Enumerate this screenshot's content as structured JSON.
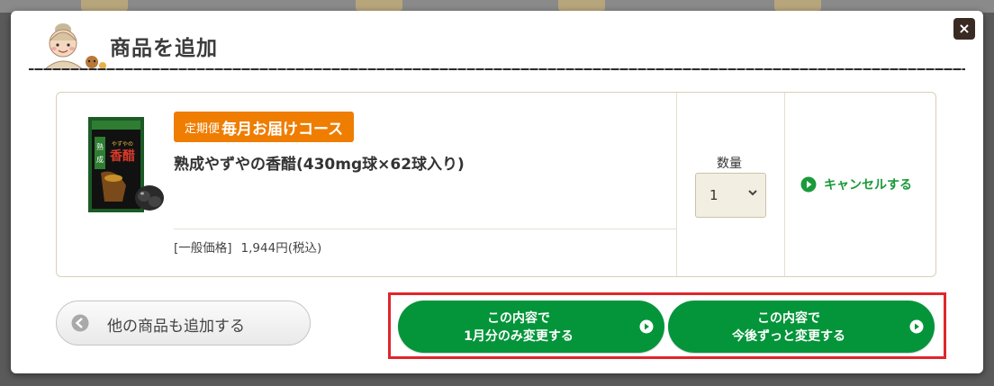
{
  "dialog": {
    "title": "商品を追加",
    "close_label": "×"
  },
  "product": {
    "badge_small": "定期便",
    "badge_big": "毎月お届けコース",
    "name": "熟成やずやの香醋(430mg球×62球入り)",
    "price_label": "[一般価格]",
    "price_value": "1,944円(税込)",
    "package_text": "熟成 やずやの 香醋"
  },
  "quantity": {
    "label": "数量",
    "value": "1",
    "icon": "chevron-down-icon"
  },
  "cancel": {
    "label": "キャンセルする",
    "icon": "play-circle-icon"
  },
  "add_more": {
    "label": "他の商品も追加する",
    "icon": "arrow-left-circle-icon"
  },
  "actions": {
    "once": {
      "line1": "この内容で",
      "line2": "1月分のみ変更する"
    },
    "always": {
      "line1": "この内容で",
      "line2": "今後ずっと変更する"
    }
  },
  "colors": {
    "badge": "#ef7d00",
    "primary_green": "#04953a",
    "link_green": "#1a9a3a",
    "highlight_red": "#e0262b",
    "close_bg": "#3a2a24"
  }
}
